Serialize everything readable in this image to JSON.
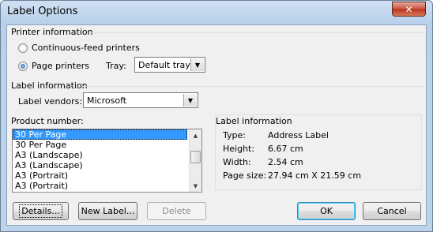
{
  "window": {
    "title": "Label Options",
    "close_glyph": "✕"
  },
  "printer_info": {
    "heading": "Printer information",
    "continuous_label": "Continuous-feed printers",
    "page_label": "Page printers",
    "tray_label": "Tray:",
    "tray_value": "Default tray"
  },
  "label_info": {
    "heading": "Label information",
    "vendors_label": "Label vendors:",
    "vendors_value": "Microsoft"
  },
  "product": {
    "heading": "Product number:",
    "items": [
      "30 Per Page",
      "30 Per Page",
      "A3 (Landscape)",
      "A3 (Landscape)",
      "A3 (Portrait)",
      "A3 (Portrait)"
    ],
    "selected_index": 0
  },
  "details_panel": {
    "heading": "Label information",
    "rows": [
      {
        "key": "Type:",
        "value": "Address Label"
      },
      {
        "key": "Height:",
        "value": "6.67 cm"
      },
      {
        "key": "Width:",
        "value": "2.54 cm"
      },
      {
        "key": "Page size:",
        "value": "27.94 cm X 21.59 cm"
      }
    ]
  },
  "buttons": {
    "details": "Details...",
    "new_label": "New Label...",
    "delete": "Delete",
    "ok": "OK",
    "cancel": "Cancel"
  },
  "colors": {
    "selection": "#3399ff",
    "dialog_bg": "#f0f0f0",
    "title_bar": "#b9d1ea"
  }
}
